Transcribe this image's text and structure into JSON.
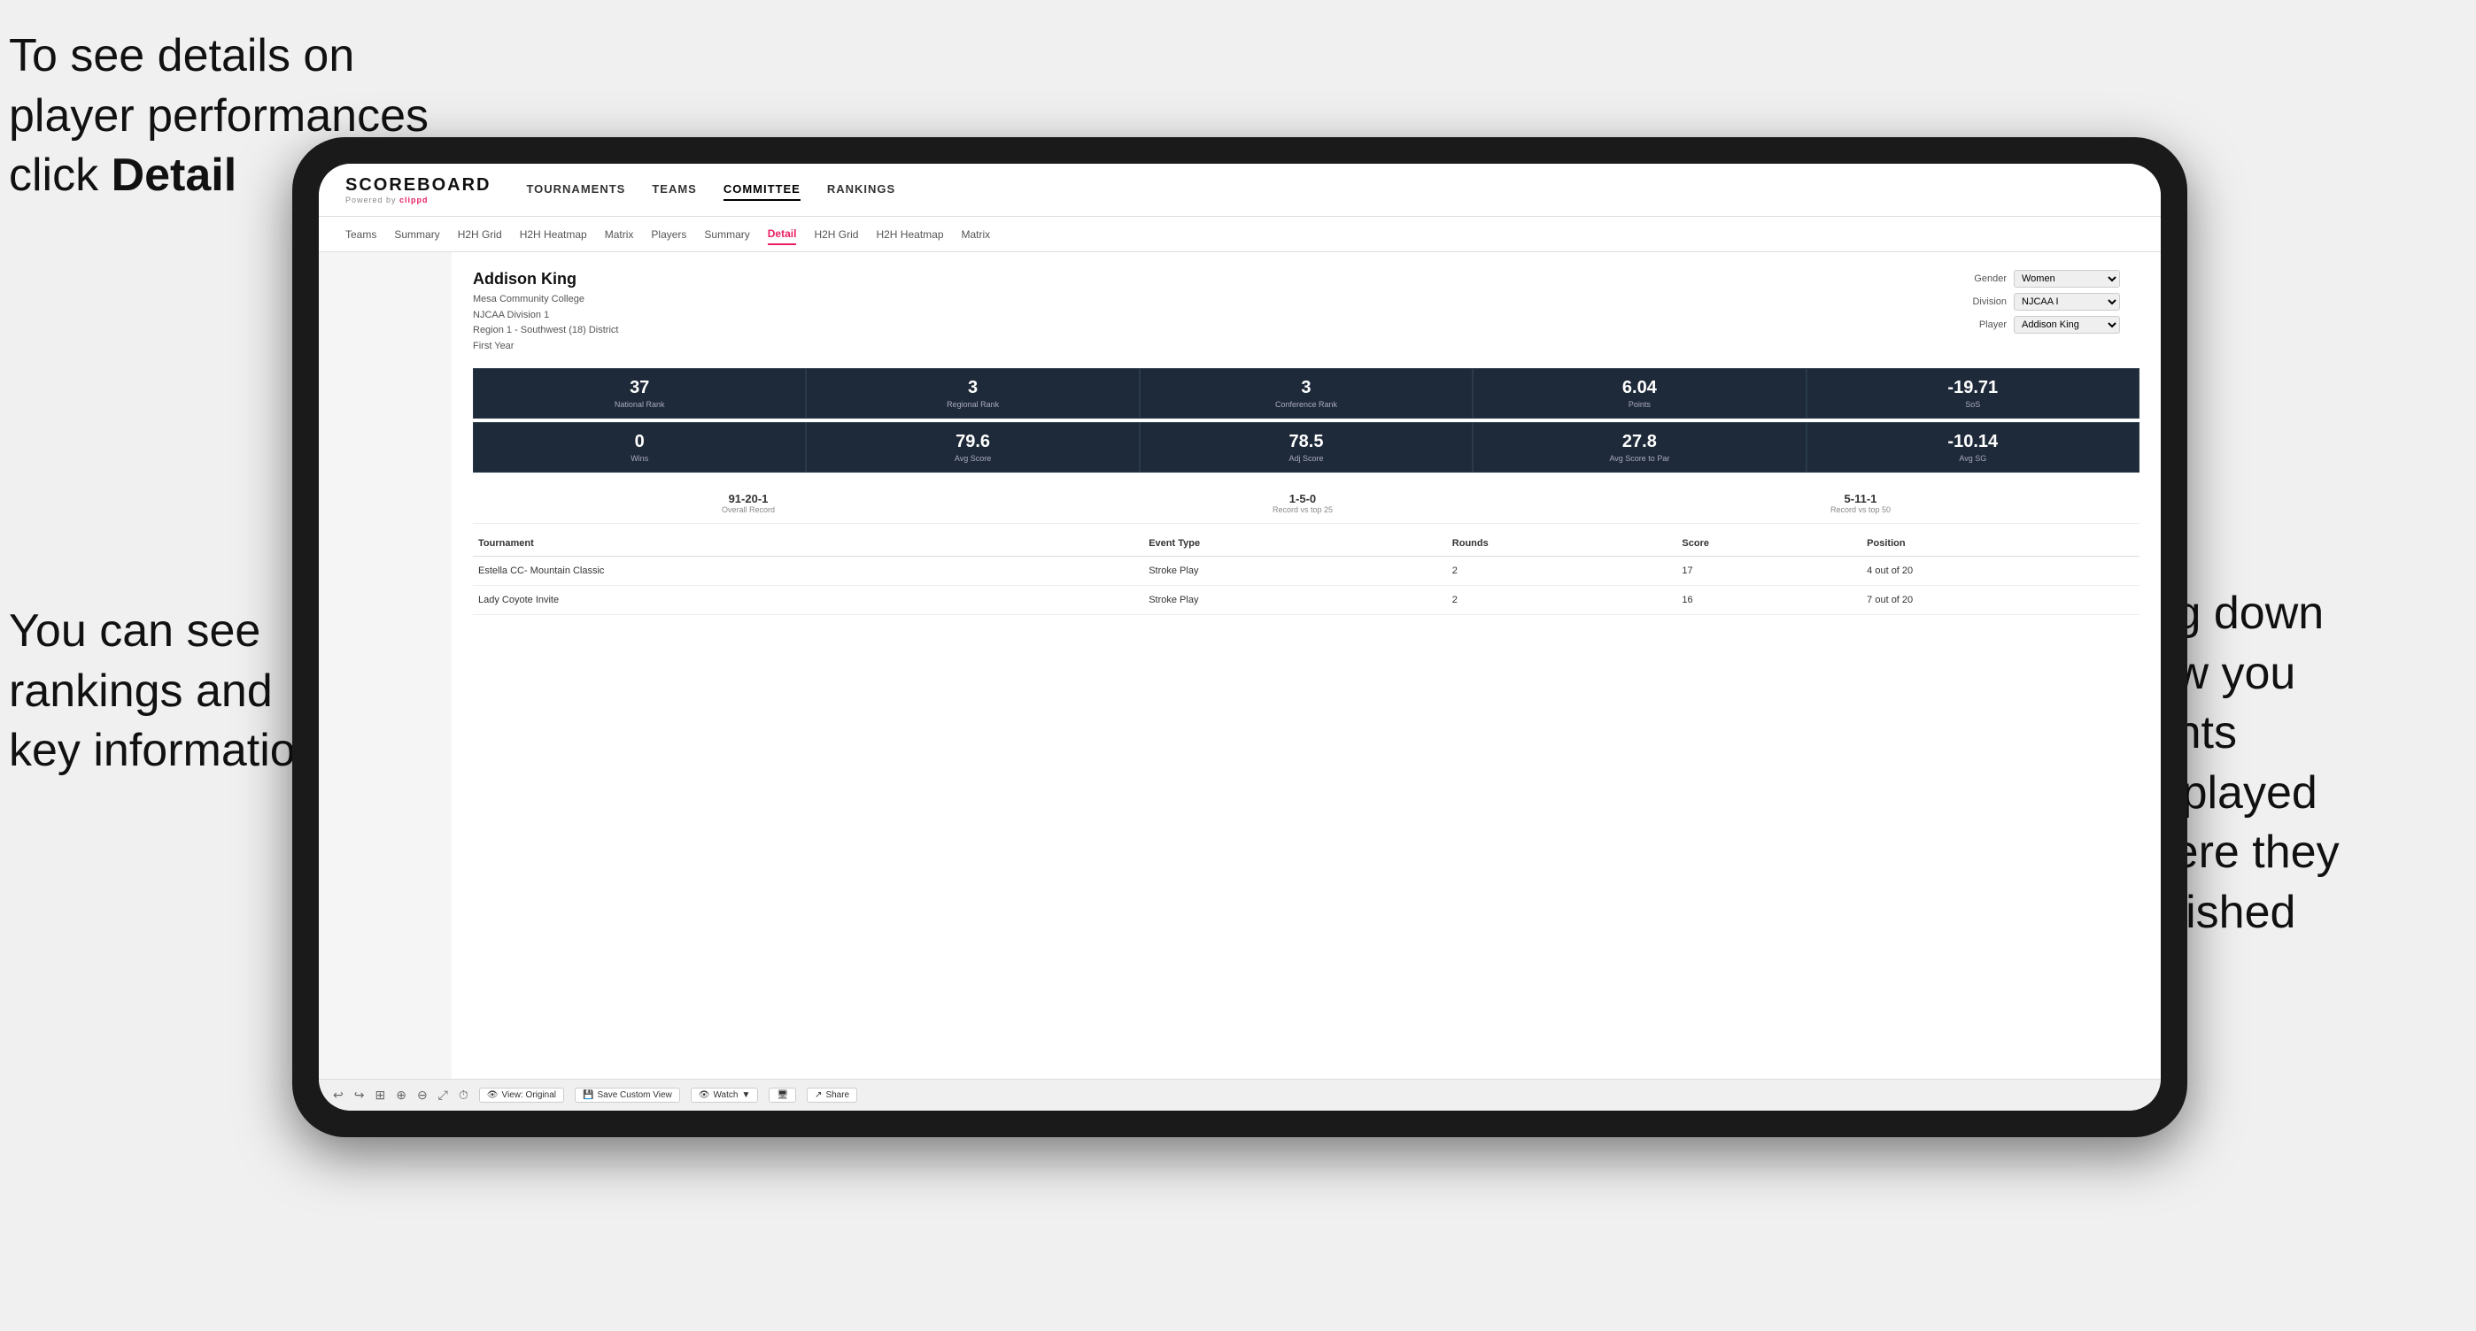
{
  "annotations": {
    "topleft": {
      "line1": "To see details on",
      "line2": "player performances",
      "line3_prefix": "click ",
      "line3_bold": "Detail"
    },
    "bottomleft": {
      "line1": "You can see",
      "line2": "rankings and",
      "line3": "key information"
    },
    "bottomright": {
      "line1": "Scrolling down",
      "line2": "will show you",
      "line3": "the events",
      "line4": "they've played",
      "line5": "and where they",
      "line6": "have finished"
    }
  },
  "nav": {
    "logo": "SCOREBOARD",
    "logo_sub": "Powered by clippd",
    "items": [
      "TOURNAMENTS",
      "TEAMS",
      "COMMITTEE",
      "RANKINGS"
    ]
  },
  "subnav": {
    "items": [
      "Teams",
      "Summary",
      "H2H Grid",
      "H2H Heatmap",
      "Matrix",
      "Players",
      "Summary",
      "Detail",
      "H2H Grid",
      "H2H Heatmap",
      "Matrix"
    ]
  },
  "player": {
    "name": "Addison King",
    "college": "Mesa Community College",
    "division": "NJCAA Division 1",
    "region": "Region 1 - Southwest (18) District",
    "year": "First Year",
    "gender_label": "Gender",
    "gender_value": "Women",
    "division_label": "Division",
    "division_value": "NJCAA I",
    "player_label": "Player",
    "player_value": "Addison King"
  },
  "stats_row1": [
    {
      "value": "37",
      "label": "National Rank"
    },
    {
      "value": "3",
      "label": "Regional Rank"
    },
    {
      "value": "3",
      "label": "Conference Rank"
    },
    {
      "value": "6.04",
      "label": "Points"
    },
    {
      "value": "-19.71",
      "label": "SoS"
    }
  ],
  "stats_row2": [
    {
      "value": "0",
      "label": "Wins"
    },
    {
      "value": "79.6",
      "label": "Avg Score"
    },
    {
      "value": "78.5",
      "label": "Adj Score"
    },
    {
      "value": "27.8",
      "label": "Avg Score to Par"
    },
    {
      "value": "-10.14",
      "label": "Avg SG"
    }
  ],
  "records": [
    {
      "value": "91-20-1",
      "label": "Overall Record"
    },
    {
      "value": "1-5-0",
      "label": "Record vs top 25"
    },
    {
      "value": "5-11-1",
      "label": "Record vs top 50"
    }
  ],
  "table": {
    "headers": [
      "Tournament",
      "Event Type",
      "Rounds",
      "Score",
      "Position"
    ],
    "rows": [
      {
        "tournament": "Estella CC- Mountain Classic",
        "event_type": "Stroke Play",
        "rounds": "2",
        "score": "17",
        "position": "4 out of 20"
      },
      {
        "tournament": "Lady Coyote Invite",
        "event_type": "Stroke Play",
        "rounds": "2",
        "score": "16",
        "position": "7 out of 20"
      }
    ]
  },
  "toolbar": {
    "view_label": "View: Original",
    "save_label": "Save Custom View",
    "watch_label": "Watch",
    "share_label": "Share"
  }
}
